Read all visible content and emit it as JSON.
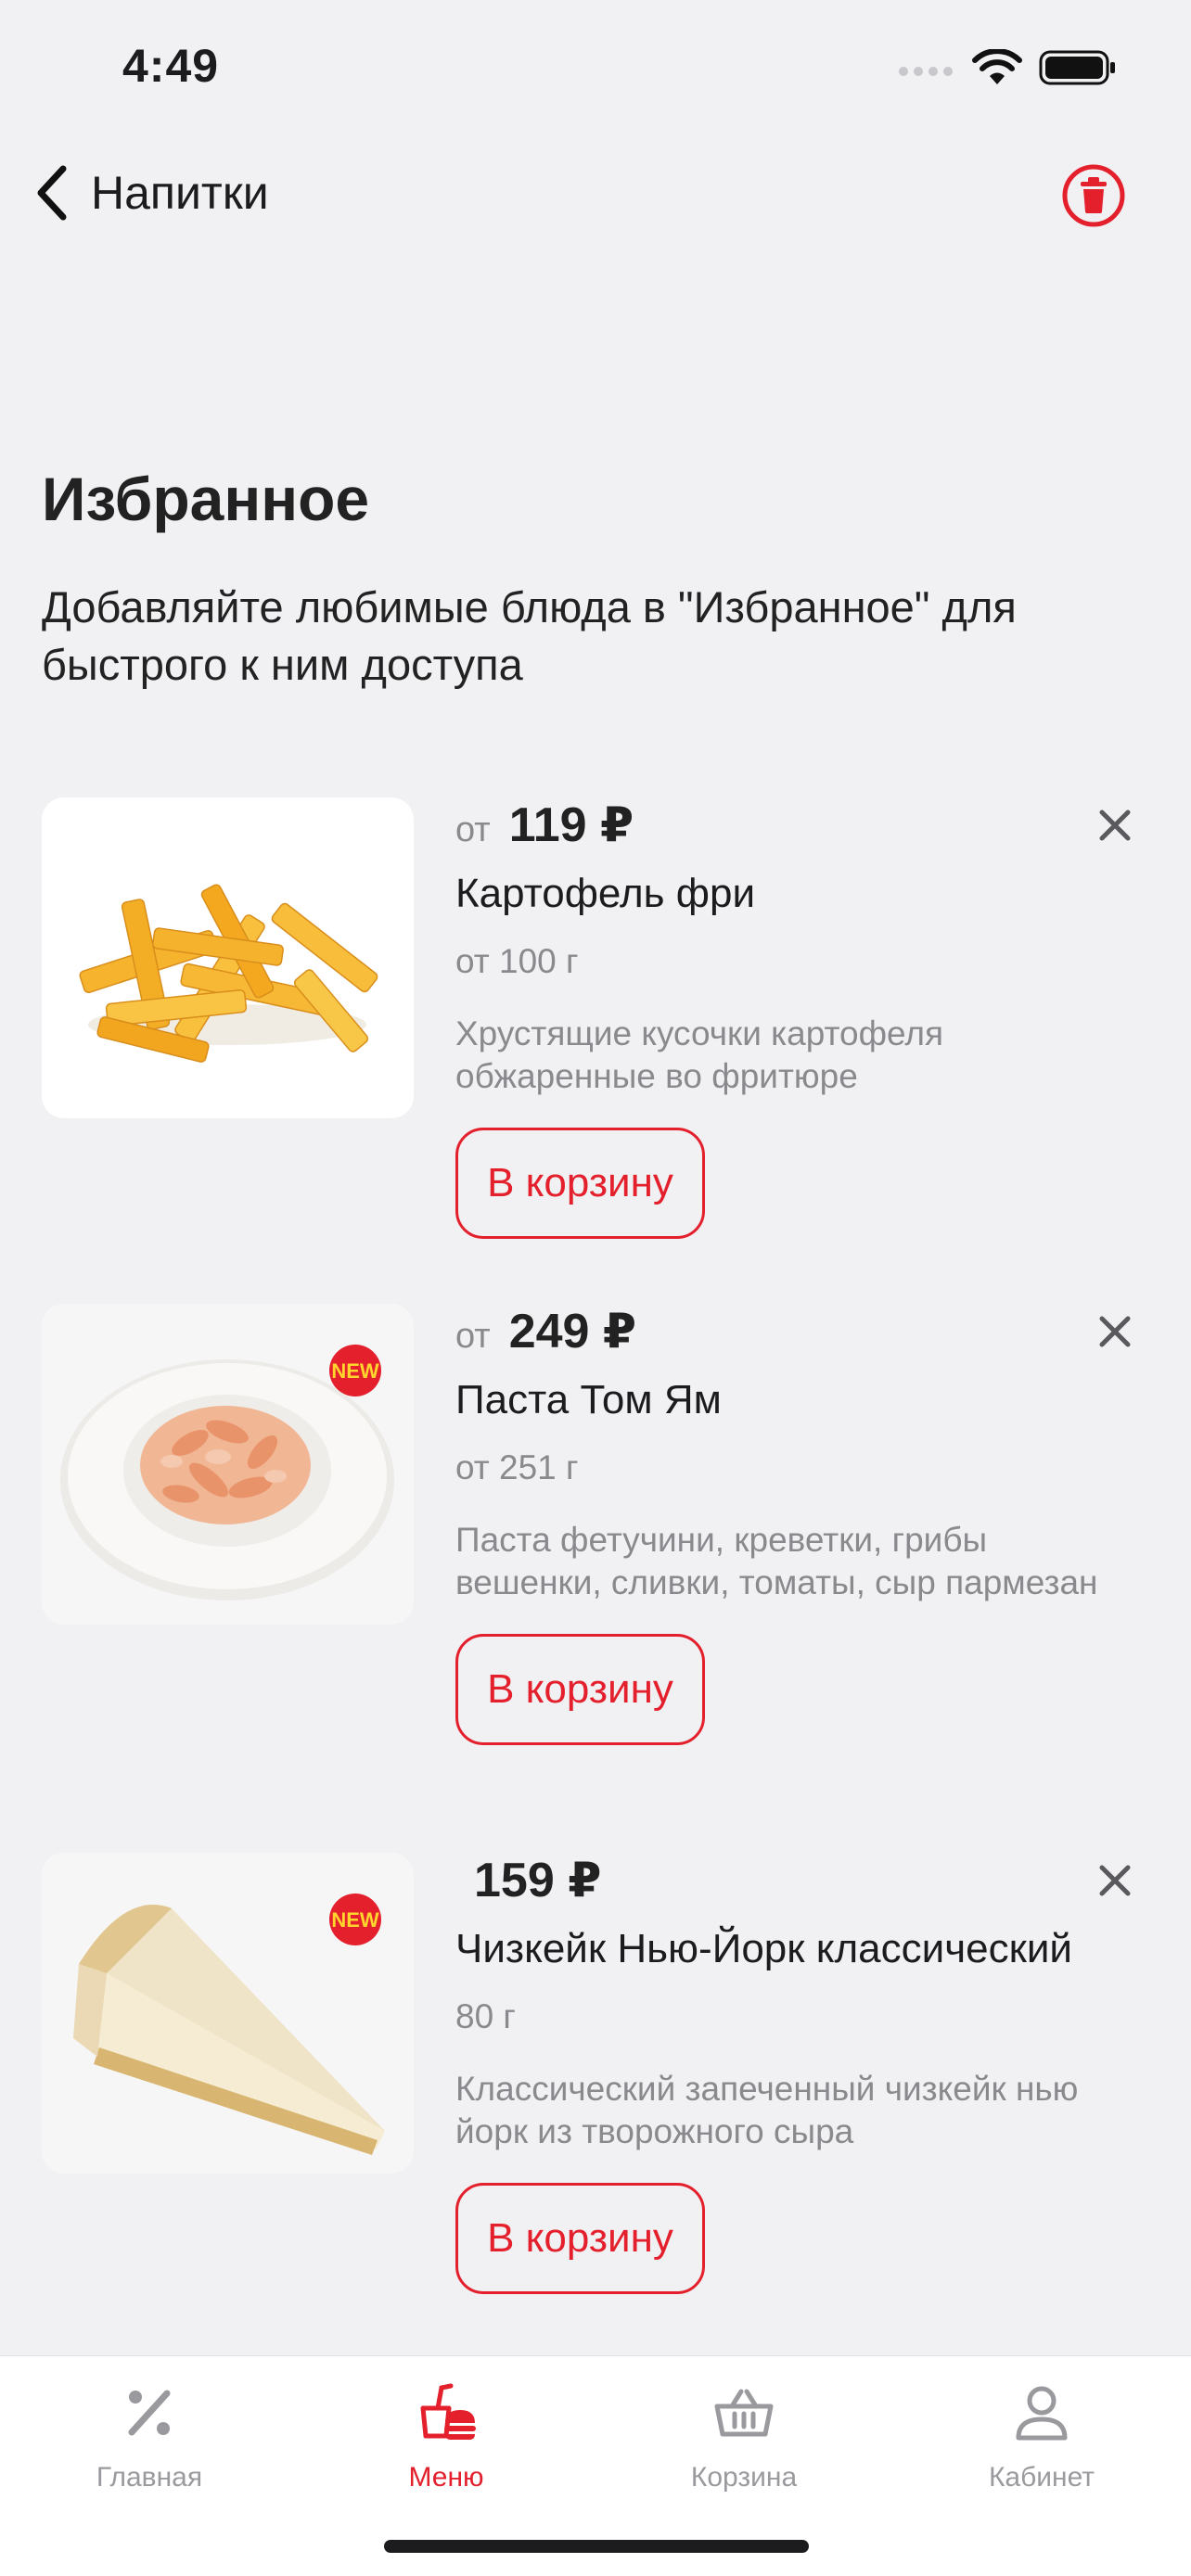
{
  "status_bar": {
    "time": "4:49",
    "icons": [
      "cellular-signal-icon",
      "wifi-icon",
      "battery-icon"
    ]
  },
  "nav": {
    "back_label": "Напитки",
    "trash_icon": "trash-icon"
  },
  "page": {
    "title": "Избранное",
    "subtitle": "Добавляйте любимые блюда в \"Избранное\" для быстрого к ним доступа"
  },
  "favorites": [
    {
      "price_prefix": "от",
      "price": "119 ₽",
      "name": "Картофель фри",
      "weight": "от 100 г",
      "description": "Хрустящие кусочки картофеля обжаренные во фритюре",
      "button": "В корзину",
      "new_badge": ""
    },
    {
      "price_prefix": "от",
      "price": "249 ₽",
      "name": "Паста Том Ям",
      "weight": "от 251 г",
      "description": "Паста фетучини, креветки, грибы вешенки, сливки, томаты, сыр пармезан",
      "button": "В корзину",
      "new_badge": "NEW"
    },
    {
      "price_prefix": "",
      "price": "159 ₽",
      "name": "Чизкейк Нью-Йорк классический",
      "weight": "80 г",
      "description": "Классический запеченный чизкейк нью йорк из творожного сыра",
      "button": "В корзину",
      "new_badge": "NEW"
    }
  ],
  "tabbar": {
    "active": "Меню",
    "tabs": [
      {
        "label": "Главная",
        "icon": "percent-icon"
      },
      {
        "label": "Меню",
        "icon": "food-menu-icon"
      },
      {
        "label": "Корзина",
        "icon": "basket-icon"
      },
      {
        "label": "Кабинет",
        "icon": "user-icon"
      }
    ]
  },
  "colors": {
    "accent": "#e3202c",
    "background": "#f1f1f3",
    "secondary_text": "#8a8a8e"
  }
}
